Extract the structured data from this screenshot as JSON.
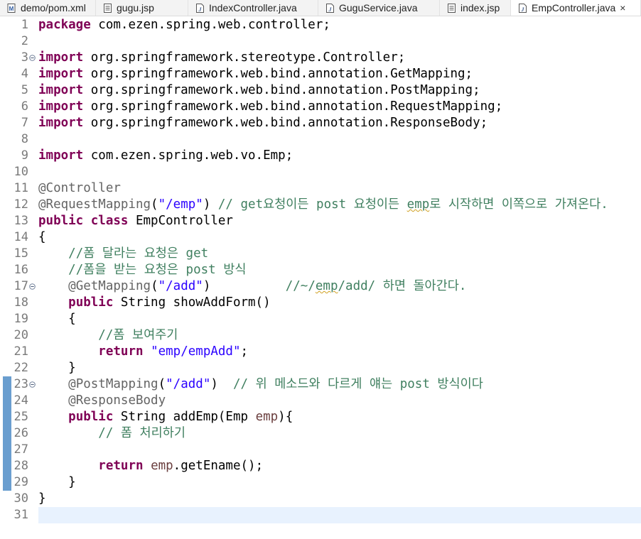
{
  "tabs": [
    {
      "label": "demo/pom.xml",
      "icon": "maven-file-icon",
      "active": false
    },
    {
      "label": "gugu.jsp",
      "icon": "jsp-file-icon",
      "active": false
    },
    {
      "label": "IndexController.java",
      "icon": "java-file-icon",
      "active": false
    },
    {
      "label": "GuguService.java",
      "icon": "java-file-icon",
      "active": false
    },
    {
      "label": "index.jsp",
      "icon": "jsp-file-icon",
      "active": false
    },
    {
      "label": "EmpController.java",
      "icon": "java-file-icon",
      "active": true
    }
  ],
  "close_icon": "×",
  "colors": {
    "keyword": "#7f0055",
    "string": "#2a00ff",
    "comment": "#3f7f5f",
    "annotation": "#646464",
    "change_bar": "#6a9ecf",
    "current_line": "#e8f2fe"
  },
  "editor": {
    "current_line": 31,
    "changed_lines": [
      23,
      24,
      25,
      26,
      27,
      28,
      29
    ],
    "lines": [
      {
        "n": "1",
        "segments": [
          {
            "t": "kw",
            "v": "package"
          },
          {
            "t": "p",
            "v": " com.ezen.spring.web.controller;"
          }
        ]
      },
      {
        "n": "2",
        "segments": []
      },
      {
        "n": "3",
        "fold": true,
        "segments": [
          {
            "t": "kw",
            "v": "import"
          },
          {
            "t": "p",
            "v": " org.springframework.stereotype.Controller;"
          }
        ]
      },
      {
        "n": "4",
        "segments": [
          {
            "t": "kw",
            "v": "import"
          },
          {
            "t": "p",
            "v": " org.springframework.web.bind.annotation.GetMapping;"
          }
        ]
      },
      {
        "n": "5",
        "segments": [
          {
            "t": "kw",
            "v": "import"
          },
          {
            "t": "p",
            "v": " org.springframework.web.bind.annotation.PostMapping;"
          }
        ]
      },
      {
        "n": "6",
        "segments": [
          {
            "t": "kw",
            "v": "import"
          },
          {
            "t": "p",
            "v": " org.springframework.web.bind.annotation.RequestMapping;"
          }
        ]
      },
      {
        "n": "7",
        "segments": [
          {
            "t": "kw",
            "v": "import"
          },
          {
            "t": "p",
            "v": " org.springframework.web.bind.annotation.ResponseBody;"
          }
        ]
      },
      {
        "n": "8",
        "segments": []
      },
      {
        "n": "9",
        "segments": [
          {
            "t": "kw",
            "v": "import"
          },
          {
            "t": "p",
            "v": " com.ezen.spring.web.vo.Emp;"
          }
        ]
      },
      {
        "n": "10",
        "segments": []
      },
      {
        "n": "11",
        "segments": [
          {
            "t": "ann",
            "v": "@Controller"
          }
        ]
      },
      {
        "n": "12",
        "segments": [
          {
            "t": "ann",
            "v": "@RequestMapping"
          },
          {
            "t": "p",
            "v": "("
          },
          {
            "t": "str",
            "v": "\"/emp\""
          },
          {
            "t": "p",
            "v": ") "
          },
          {
            "t": "cmt",
            "v": "// get요청이든 post 요청이든 "
          },
          {
            "t": "cmtsq",
            "v": "emp"
          },
          {
            "t": "cmt",
            "v": "로 시작하면 이쪽으로 가져온다."
          }
        ]
      },
      {
        "n": "13",
        "segments": [
          {
            "t": "kw",
            "v": "public"
          },
          {
            "t": "p",
            "v": " "
          },
          {
            "t": "kw",
            "v": "class"
          },
          {
            "t": "p",
            "v": " EmpController"
          }
        ]
      },
      {
        "n": "14",
        "segments": [
          {
            "t": "p",
            "v": "{"
          }
        ]
      },
      {
        "n": "15",
        "segments": [
          {
            "t": "p",
            "v": "    "
          },
          {
            "t": "cmt",
            "v": "//폼 달라는 요청은 get"
          }
        ]
      },
      {
        "n": "16",
        "segments": [
          {
            "t": "p",
            "v": "    "
          },
          {
            "t": "cmt",
            "v": "//폼을 받는 요청은 post 방식"
          }
        ]
      },
      {
        "n": "17",
        "fold": true,
        "segments": [
          {
            "t": "p",
            "v": "    "
          },
          {
            "t": "ann",
            "v": "@GetMapping"
          },
          {
            "t": "p",
            "v": "("
          },
          {
            "t": "str",
            "v": "\"/add\""
          },
          {
            "t": "p",
            "v": ")          "
          },
          {
            "t": "cmt",
            "v": "//~/"
          },
          {
            "t": "cmtsq",
            "v": "emp"
          },
          {
            "t": "cmt",
            "v": "/add/ 하면 돌아간다."
          }
        ]
      },
      {
        "n": "18",
        "segments": [
          {
            "t": "p",
            "v": "    "
          },
          {
            "t": "kw",
            "v": "public"
          },
          {
            "t": "p",
            "v": " String showAddForm()"
          }
        ]
      },
      {
        "n": "19",
        "segments": [
          {
            "t": "p",
            "v": "    {"
          }
        ]
      },
      {
        "n": "20",
        "segments": [
          {
            "t": "p",
            "v": "        "
          },
          {
            "t": "cmt",
            "v": "//폼 보여주기"
          }
        ]
      },
      {
        "n": "21",
        "segments": [
          {
            "t": "p",
            "v": "        "
          },
          {
            "t": "kw",
            "v": "return"
          },
          {
            "t": "p",
            "v": " "
          },
          {
            "t": "str",
            "v": "\"emp/empAdd\""
          },
          {
            "t": "p",
            "v": ";"
          }
        ]
      },
      {
        "n": "22",
        "segments": [
          {
            "t": "p",
            "v": "    }"
          }
        ]
      },
      {
        "n": "23",
        "fold": true,
        "segments": [
          {
            "t": "p",
            "v": "    "
          },
          {
            "t": "ann",
            "v": "@PostMapping"
          },
          {
            "t": "p",
            "v": "("
          },
          {
            "t": "str",
            "v": "\"/add\""
          },
          {
            "t": "p",
            "v": ")  "
          },
          {
            "t": "cmt",
            "v": "// 위 메소드와 다르게 얘는 post 방식이다"
          }
        ]
      },
      {
        "n": "24",
        "segments": [
          {
            "t": "p",
            "v": "    "
          },
          {
            "t": "ann",
            "v": "@ResponseBody"
          }
        ]
      },
      {
        "n": "25",
        "segments": [
          {
            "t": "p",
            "v": "    "
          },
          {
            "t": "kw",
            "v": "public"
          },
          {
            "t": "p",
            "v": " String addEmp(Emp "
          },
          {
            "t": "param",
            "v": "emp"
          },
          {
            "t": "p",
            "v": "){"
          }
        ]
      },
      {
        "n": "26",
        "segments": [
          {
            "t": "p",
            "v": "        "
          },
          {
            "t": "cmt",
            "v": "// 폼 처리하기"
          }
        ]
      },
      {
        "n": "27",
        "segments": []
      },
      {
        "n": "28",
        "segments": [
          {
            "t": "p",
            "v": "        "
          },
          {
            "t": "kw",
            "v": "return"
          },
          {
            "t": "p",
            "v": " "
          },
          {
            "t": "param",
            "v": "emp"
          },
          {
            "t": "p",
            "v": ".getEname();"
          }
        ]
      },
      {
        "n": "29",
        "segments": [
          {
            "t": "p",
            "v": "    }"
          }
        ]
      },
      {
        "n": "30",
        "segments": [
          {
            "t": "p",
            "v": "}"
          }
        ]
      },
      {
        "n": "31",
        "segments": []
      }
    ]
  }
}
